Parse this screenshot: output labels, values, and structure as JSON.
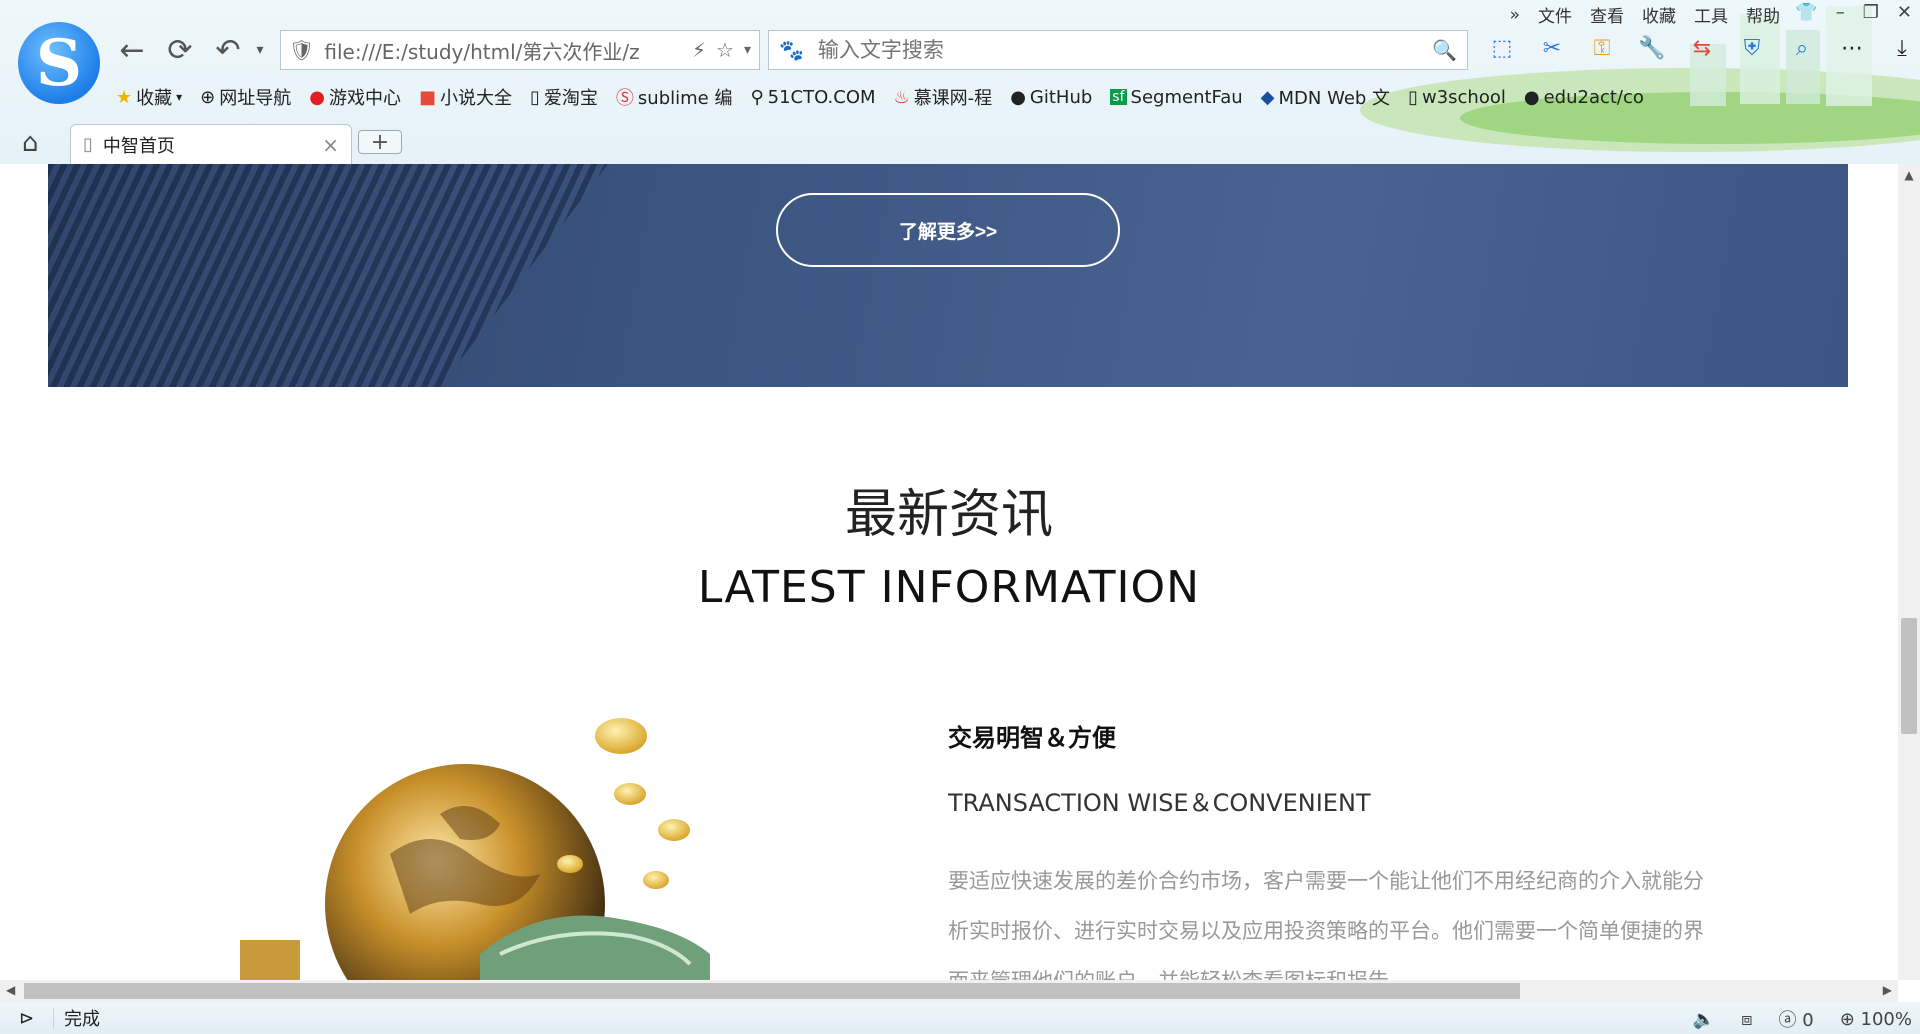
{
  "browser": {
    "menu": [
      "文件",
      "查看",
      "收藏",
      "工具",
      "帮助"
    ],
    "address_url": "file:///E:/study/html/第六次作业/z",
    "search_placeholder": "输入文字搜索",
    "bookmarks": [
      {
        "label": "收藏",
        "icon": "star-icon"
      },
      {
        "label": "网址导航",
        "icon": "globe-icon"
      },
      {
        "label": "游戏中心",
        "icon": "game-icon"
      },
      {
        "label": "小说大全",
        "icon": "book-icon"
      },
      {
        "label": "爱淘宝",
        "icon": "page-icon"
      },
      {
        "label": "sublime 编",
        "icon": "s-icon"
      },
      {
        "label": "51CTO.COM",
        "icon": "link-icon"
      },
      {
        "label": "慕课网-程",
        "icon": "fire-icon"
      },
      {
        "label": "GitHub",
        "icon": "github-icon"
      },
      {
        "label": "SegmentFau",
        "icon": "sf-icon"
      },
      {
        "label": "MDN Web 文",
        "icon": "mdn-icon"
      },
      {
        "label": "w3school",
        "icon": "page-icon"
      },
      {
        "label": "edu2act/co",
        "icon": "github-icon"
      }
    ],
    "tab_title": "中智首页",
    "status_text": "完成",
    "status_count": "0",
    "zoom": "100%"
  },
  "page": {
    "banner_button": "了解更多>>",
    "news_title_cn": "最新资讯",
    "news_title_en": "LATEST INFORMATION",
    "article": {
      "title": "交易明智＆方便",
      "subtitle": "TRANSACTION WISE＆CONVENIENT",
      "body": "要适应快速发展的差价合约市场，客户需要一个能让他们不用经纪商的介入就能分析实时报价、进行实时交易以及应用投资策略的平台。他们需要一个简单便捷的界面来管理他们的账户，并能轻松查看图标和报告。"
    }
  }
}
